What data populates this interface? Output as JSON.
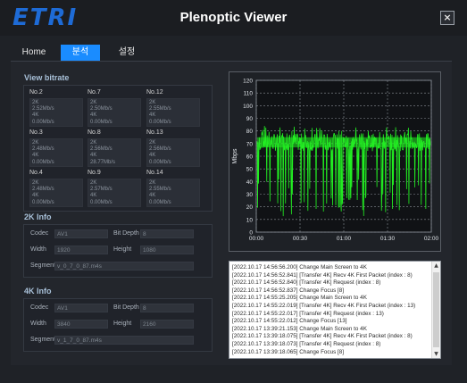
{
  "window": {
    "logo": "ETRI",
    "title": "Plenoptic Viewer",
    "close_glyph": "×"
  },
  "tabs": [
    {
      "label": "Home"
    },
    {
      "label": "분석"
    },
    {
      "label": "설정"
    }
  ],
  "bitrate": {
    "title": "View bitrate",
    "cells": [
      {
        "name": "No.2",
        "lines": [
          "2K",
          "2.52Mb/s",
          "4K",
          "0.00Mb/s"
        ]
      },
      {
        "name": "No.7",
        "lines": [
          "2K",
          "2.50Mb/s",
          "4K",
          "0.00Mb/s"
        ]
      },
      {
        "name": "No.12",
        "lines": [
          "2K",
          "2.55Mb/s",
          "4K",
          "0.00Mb/s"
        ]
      },
      {
        "name": "No.3",
        "lines": [
          "2K",
          "2.48Mb/s",
          "4K",
          "0.00Mb/s"
        ]
      },
      {
        "name": "No.8",
        "lines": [
          "2K",
          "2.56Mb/s",
          "4K",
          "28.77Mb/s"
        ]
      },
      {
        "name": "No.13",
        "lines": [
          "2K",
          "2.56Mb/s",
          "4K",
          "0.00Mb/s"
        ]
      },
      {
        "name": "No.4",
        "lines": [
          "2K",
          "2.48Mb/s",
          "4K",
          "0.00Mb/s"
        ]
      },
      {
        "name": "No.9",
        "lines": [
          "2K",
          "2.57Mb/s",
          "4K",
          "0.00Mb/s"
        ]
      },
      {
        "name": "No.14",
        "lines": [
          "2K",
          "2.55Mb/s",
          "4K",
          "0.00Mb/s"
        ]
      }
    ]
  },
  "info2k": {
    "title": "2K Info",
    "codec_label": "Codec",
    "codec": "AV1",
    "bitdepth_label": "Bit Depth",
    "bitdepth": "8",
    "width_label": "Width",
    "width": "1920",
    "height_label": "Height",
    "height": "1080",
    "segment_label": "Segment",
    "segment": "v_0_7_0_87.m4s"
  },
  "info4k": {
    "title": "4K Info",
    "codec_label": "Codec",
    "codec": "AV1",
    "bitdepth_label": "Bit Depth",
    "bitdepth": "8",
    "width_label": "Width",
    "width": "3840",
    "height_label": "Height",
    "height": "2160",
    "segment_label": "Segment",
    "segment": "v_1_7_0_87.m4s"
  },
  "chart_data": {
    "type": "line",
    "title": "",
    "xlabel": "",
    "ylabel": "Mbps",
    "ylim": [
      0,
      120
    ],
    "yticks": [
      "0",
      "10",
      "20",
      "30",
      "40",
      "50",
      "60",
      "70",
      "80",
      "90",
      "100",
      "110",
      "120"
    ],
    "xlim": [
      "00:00",
      "02:00"
    ],
    "xticks": [
      "00:00",
      "00:30",
      "01:00",
      "01:30",
      "02:00"
    ],
    "grid": true,
    "series": [
      {
        "color": "#22ee22",
        "band": [
          64,
          78
        ],
        "spike_max": 84,
        "drop_min": 12
      }
    ]
  },
  "log": {
    "lines": [
      "[2022.10.17 14:56:56.200]  Change Main Screen to 4K",
      "[2022.10.17 14:56:52.841]  [Transfer 4K] Recv 4K First Packet (index : 8)",
      "[2022.10.17 14:56:52.840]  [Transfer 4K] Request (index : 8)",
      "[2022.10.17 14:56:52.837]  Change Focus [8]",
      "[2022.10.17 14:55:25.205]  Change Main Screen to 4K",
      "[2022.10.17 14:55:22.019]  [Transfer 4K] Recv 4K First Packet (index : 13)",
      "[2022.10.17 14:55:22.017]  [Transfer 4K] Request (index : 13)",
      "[2022.10.17 14:55:22.012]  Change Focus [13]",
      "[2022.10.17 13:39:21.153]  Change Main Screen to 4K",
      "[2022.10.17 13:39:18.075]  [Transfer 4K] Recv 4K First Packet (index : 8)",
      "[2022.10.17 13:39:18.073]  [Transfer 4K] Request (index : 8)",
      "[2022.10.17 13:39:18.065]  Change Focus [8]"
    ],
    "scroll_up": "▲",
    "scroll_down": "▼"
  }
}
